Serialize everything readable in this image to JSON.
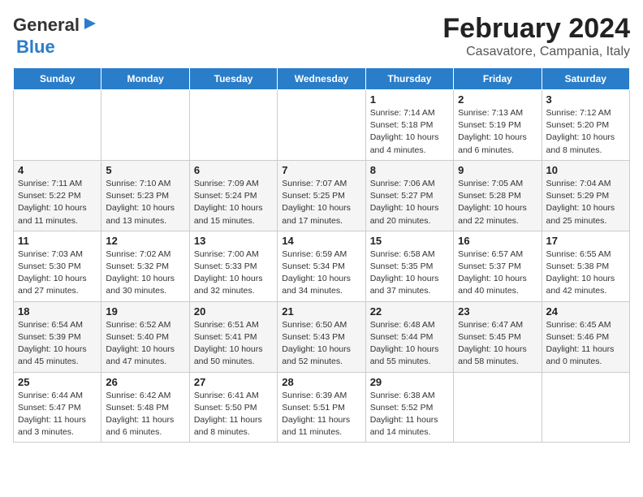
{
  "header": {
    "logo_line1": "General",
    "logo_line2": "Blue",
    "main_title": "February 2024",
    "sub_title": "Casavatore, Campania, Italy"
  },
  "days_of_week": [
    "Sunday",
    "Monday",
    "Tuesday",
    "Wednesday",
    "Thursday",
    "Friday",
    "Saturday"
  ],
  "weeks": [
    [
      {
        "day": "",
        "info": ""
      },
      {
        "day": "",
        "info": ""
      },
      {
        "day": "",
        "info": ""
      },
      {
        "day": "",
        "info": ""
      },
      {
        "day": "1",
        "info": "Sunrise: 7:14 AM\nSunset: 5:18 PM\nDaylight: 10 hours\nand 4 minutes."
      },
      {
        "day": "2",
        "info": "Sunrise: 7:13 AM\nSunset: 5:19 PM\nDaylight: 10 hours\nand 6 minutes."
      },
      {
        "day": "3",
        "info": "Sunrise: 7:12 AM\nSunset: 5:20 PM\nDaylight: 10 hours\nand 8 minutes."
      }
    ],
    [
      {
        "day": "4",
        "info": "Sunrise: 7:11 AM\nSunset: 5:22 PM\nDaylight: 10 hours\nand 11 minutes."
      },
      {
        "day": "5",
        "info": "Sunrise: 7:10 AM\nSunset: 5:23 PM\nDaylight: 10 hours\nand 13 minutes."
      },
      {
        "day": "6",
        "info": "Sunrise: 7:09 AM\nSunset: 5:24 PM\nDaylight: 10 hours\nand 15 minutes."
      },
      {
        "day": "7",
        "info": "Sunrise: 7:07 AM\nSunset: 5:25 PM\nDaylight: 10 hours\nand 17 minutes."
      },
      {
        "day": "8",
        "info": "Sunrise: 7:06 AM\nSunset: 5:27 PM\nDaylight: 10 hours\nand 20 minutes."
      },
      {
        "day": "9",
        "info": "Sunrise: 7:05 AM\nSunset: 5:28 PM\nDaylight: 10 hours\nand 22 minutes."
      },
      {
        "day": "10",
        "info": "Sunrise: 7:04 AM\nSunset: 5:29 PM\nDaylight: 10 hours\nand 25 minutes."
      }
    ],
    [
      {
        "day": "11",
        "info": "Sunrise: 7:03 AM\nSunset: 5:30 PM\nDaylight: 10 hours\nand 27 minutes."
      },
      {
        "day": "12",
        "info": "Sunrise: 7:02 AM\nSunset: 5:32 PM\nDaylight: 10 hours\nand 30 minutes."
      },
      {
        "day": "13",
        "info": "Sunrise: 7:00 AM\nSunset: 5:33 PM\nDaylight: 10 hours\nand 32 minutes."
      },
      {
        "day": "14",
        "info": "Sunrise: 6:59 AM\nSunset: 5:34 PM\nDaylight: 10 hours\nand 34 minutes."
      },
      {
        "day": "15",
        "info": "Sunrise: 6:58 AM\nSunset: 5:35 PM\nDaylight: 10 hours\nand 37 minutes."
      },
      {
        "day": "16",
        "info": "Sunrise: 6:57 AM\nSunset: 5:37 PM\nDaylight: 10 hours\nand 40 minutes."
      },
      {
        "day": "17",
        "info": "Sunrise: 6:55 AM\nSunset: 5:38 PM\nDaylight: 10 hours\nand 42 minutes."
      }
    ],
    [
      {
        "day": "18",
        "info": "Sunrise: 6:54 AM\nSunset: 5:39 PM\nDaylight: 10 hours\nand 45 minutes."
      },
      {
        "day": "19",
        "info": "Sunrise: 6:52 AM\nSunset: 5:40 PM\nDaylight: 10 hours\nand 47 minutes."
      },
      {
        "day": "20",
        "info": "Sunrise: 6:51 AM\nSunset: 5:41 PM\nDaylight: 10 hours\nand 50 minutes."
      },
      {
        "day": "21",
        "info": "Sunrise: 6:50 AM\nSunset: 5:43 PM\nDaylight: 10 hours\nand 52 minutes."
      },
      {
        "day": "22",
        "info": "Sunrise: 6:48 AM\nSunset: 5:44 PM\nDaylight: 10 hours\nand 55 minutes."
      },
      {
        "day": "23",
        "info": "Sunrise: 6:47 AM\nSunset: 5:45 PM\nDaylight: 10 hours\nand 58 minutes."
      },
      {
        "day": "24",
        "info": "Sunrise: 6:45 AM\nSunset: 5:46 PM\nDaylight: 11 hours\nand 0 minutes."
      }
    ],
    [
      {
        "day": "25",
        "info": "Sunrise: 6:44 AM\nSunset: 5:47 PM\nDaylight: 11 hours\nand 3 minutes."
      },
      {
        "day": "26",
        "info": "Sunrise: 6:42 AM\nSunset: 5:48 PM\nDaylight: 11 hours\nand 6 minutes."
      },
      {
        "day": "27",
        "info": "Sunrise: 6:41 AM\nSunset: 5:50 PM\nDaylight: 11 hours\nand 8 minutes."
      },
      {
        "day": "28",
        "info": "Sunrise: 6:39 AM\nSunset: 5:51 PM\nDaylight: 11 hours\nand 11 minutes."
      },
      {
        "day": "29",
        "info": "Sunrise: 6:38 AM\nSunset: 5:52 PM\nDaylight: 11 hours\nand 14 minutes."
      },
      {
        "day": "",
        "info": ""
      },
      {
        "day": "",
        "info": ""
      }
    ]
  ]
}
